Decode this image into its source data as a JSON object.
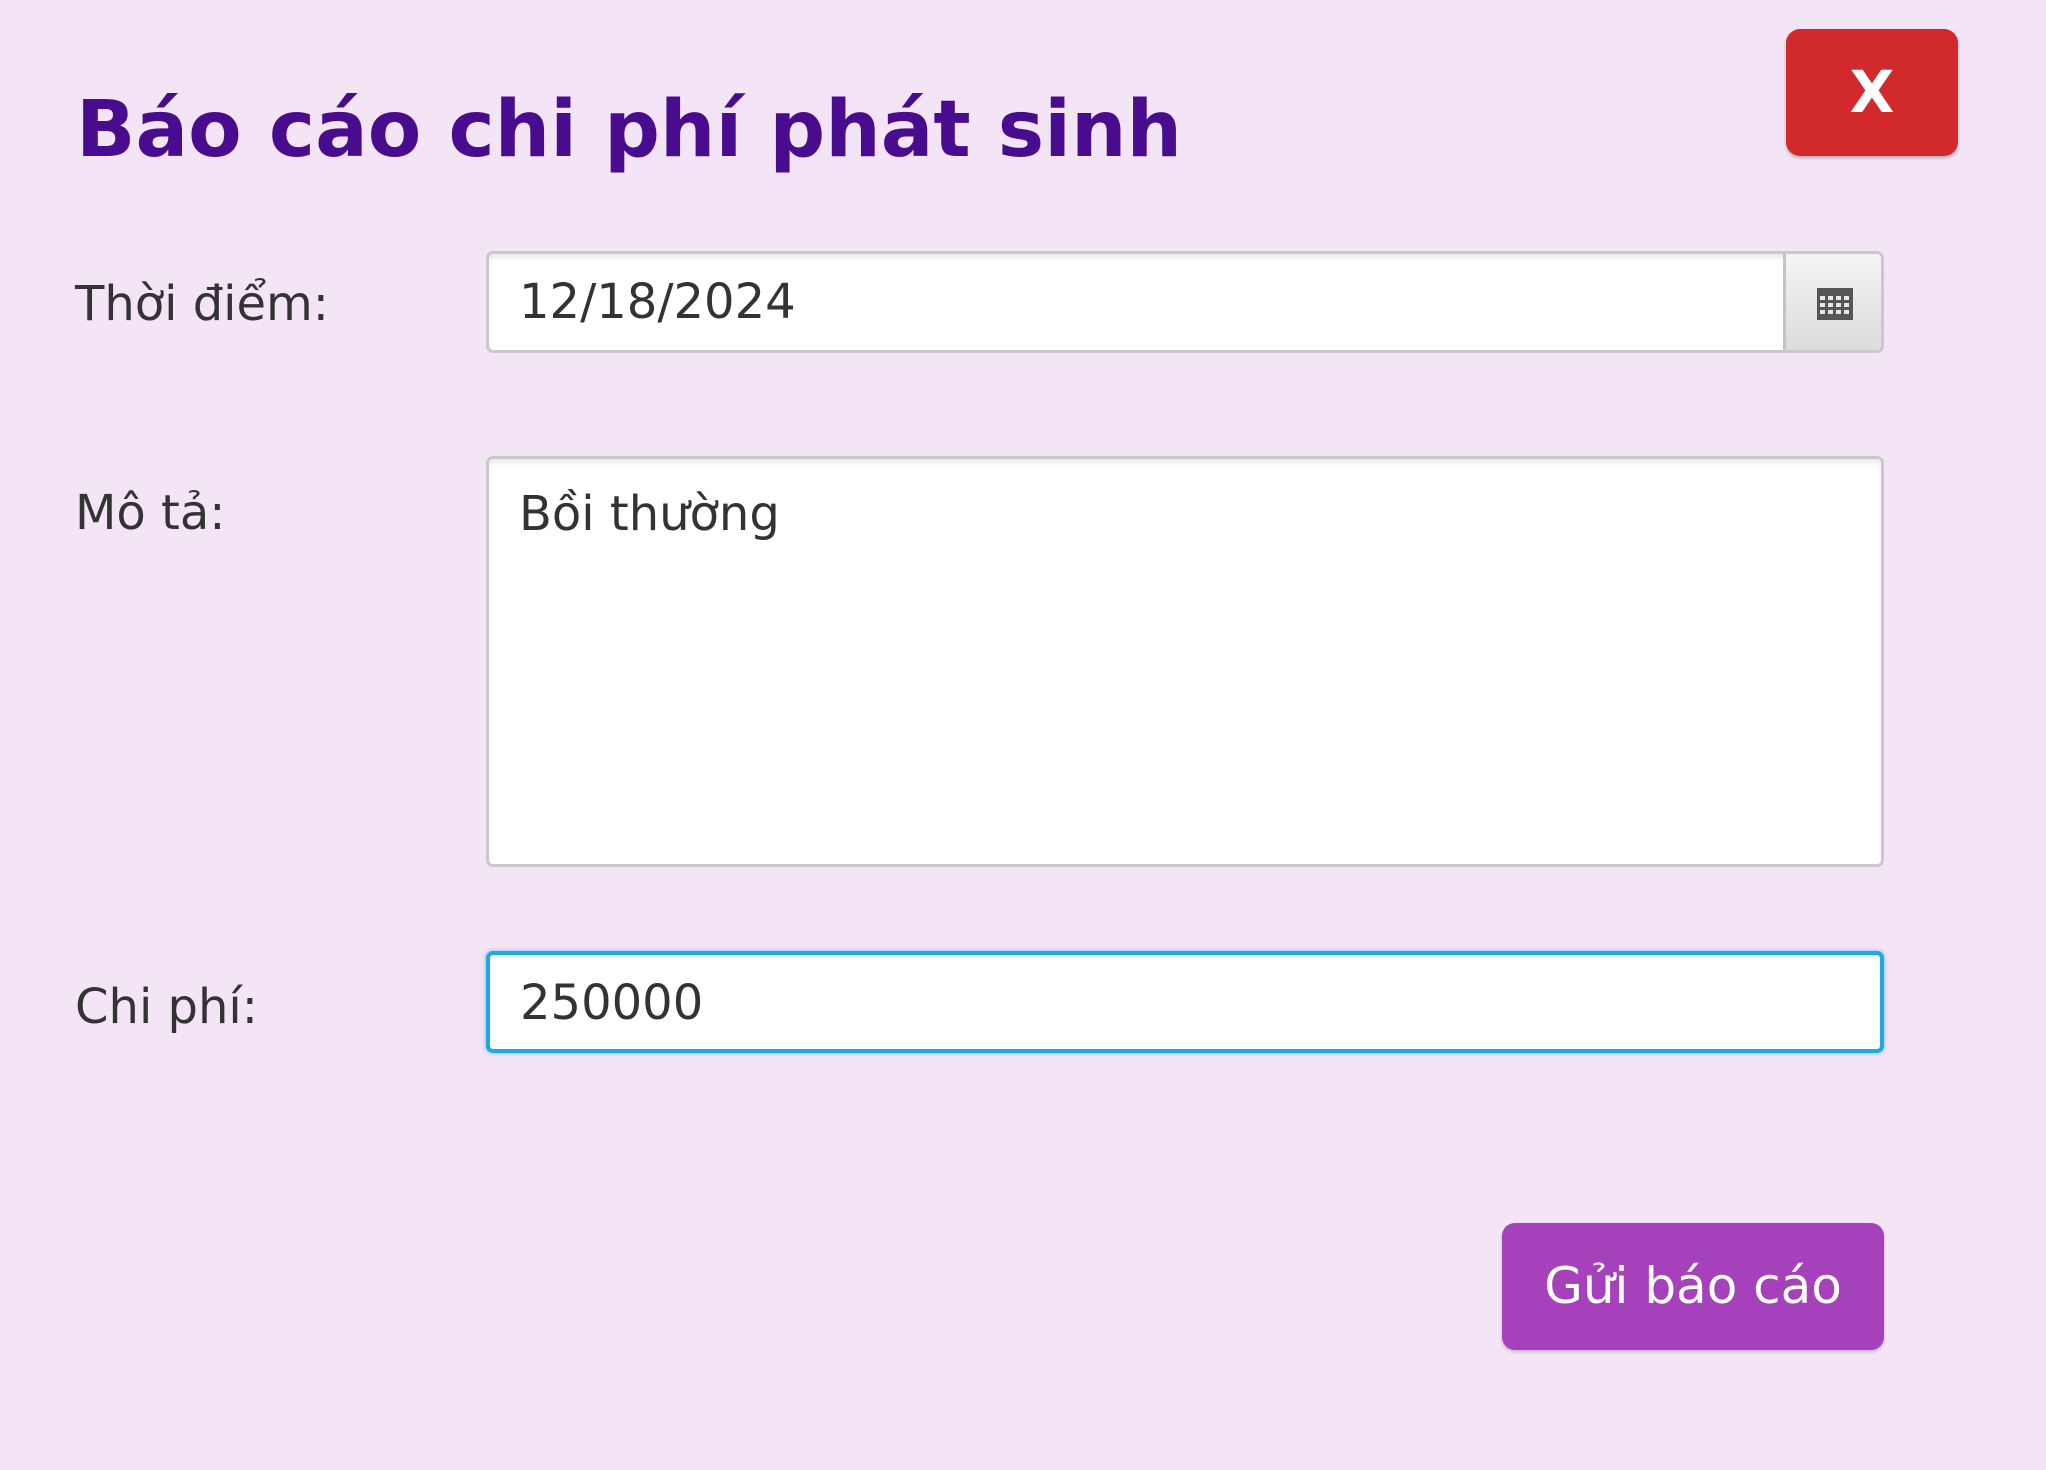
{
  "dialog": {
    "title": "Báo cáo chi phí phát sinh",
    "close_label": "X"
  },
  "form": {
    "date": {
      "label": "Thời điểm:",
      "value": "12/18/2024",
      "button_icon": "calendar-icon"
    },
    "description": {
      "label": "Mô tả:",
      "value": "Bồi thường"
    },
    "cost": {
      "label": "Chi phí:",
      "value": "250000"
    },
    "submit_label": "Gửi báo cáo"
  },
  "colors": {
    "background": "#f3e4f6",
    "title": "#4a0c8f",
    "close_button": "#d2292d",
    "submit_button": "#a641bc",
    "focus_border": "#22a7de"
  }
}
